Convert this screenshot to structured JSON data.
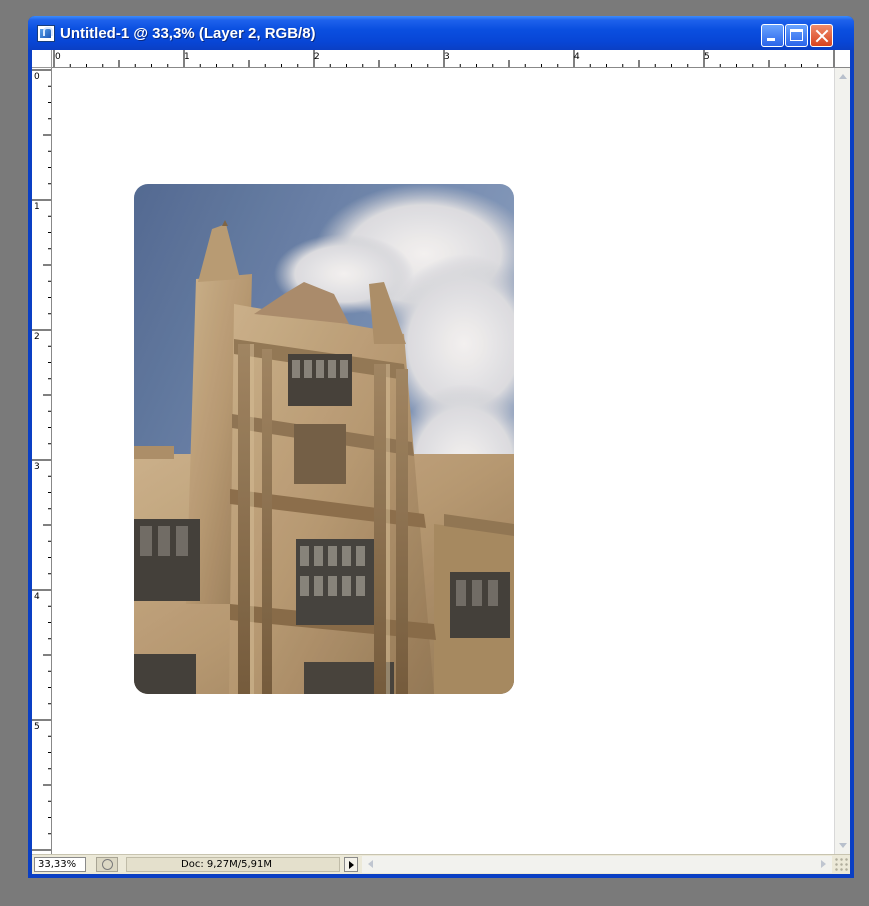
{
  "window": {
    "title": "Untitled-1 @ 33,3% (Layer 2, RGB/8)"
  },
  "rulers": {
    "horizontal_labels": [
      "0",
      "1",
      "2",
      "3",
      "4",
      "5"
    ],
    "vertical_labels": [
      "0",
      "1",
      "2",
      "3",
      "4",
      "5"
    ]
  },
  "statusbar": {
    "zoom": "33,33%",
    "doc_info": "Doc: 9,27M/5,91M"
  },
  "canvas": {
    "layer_image": "photo of a gothic stone tower against a cloudy blue sky"
  },
  "colors": {
    "titlebar": "#0a4fe0",
    "canvas_background": "#ffffff",
    "workspace": "#7a7a7a"
  }
}
